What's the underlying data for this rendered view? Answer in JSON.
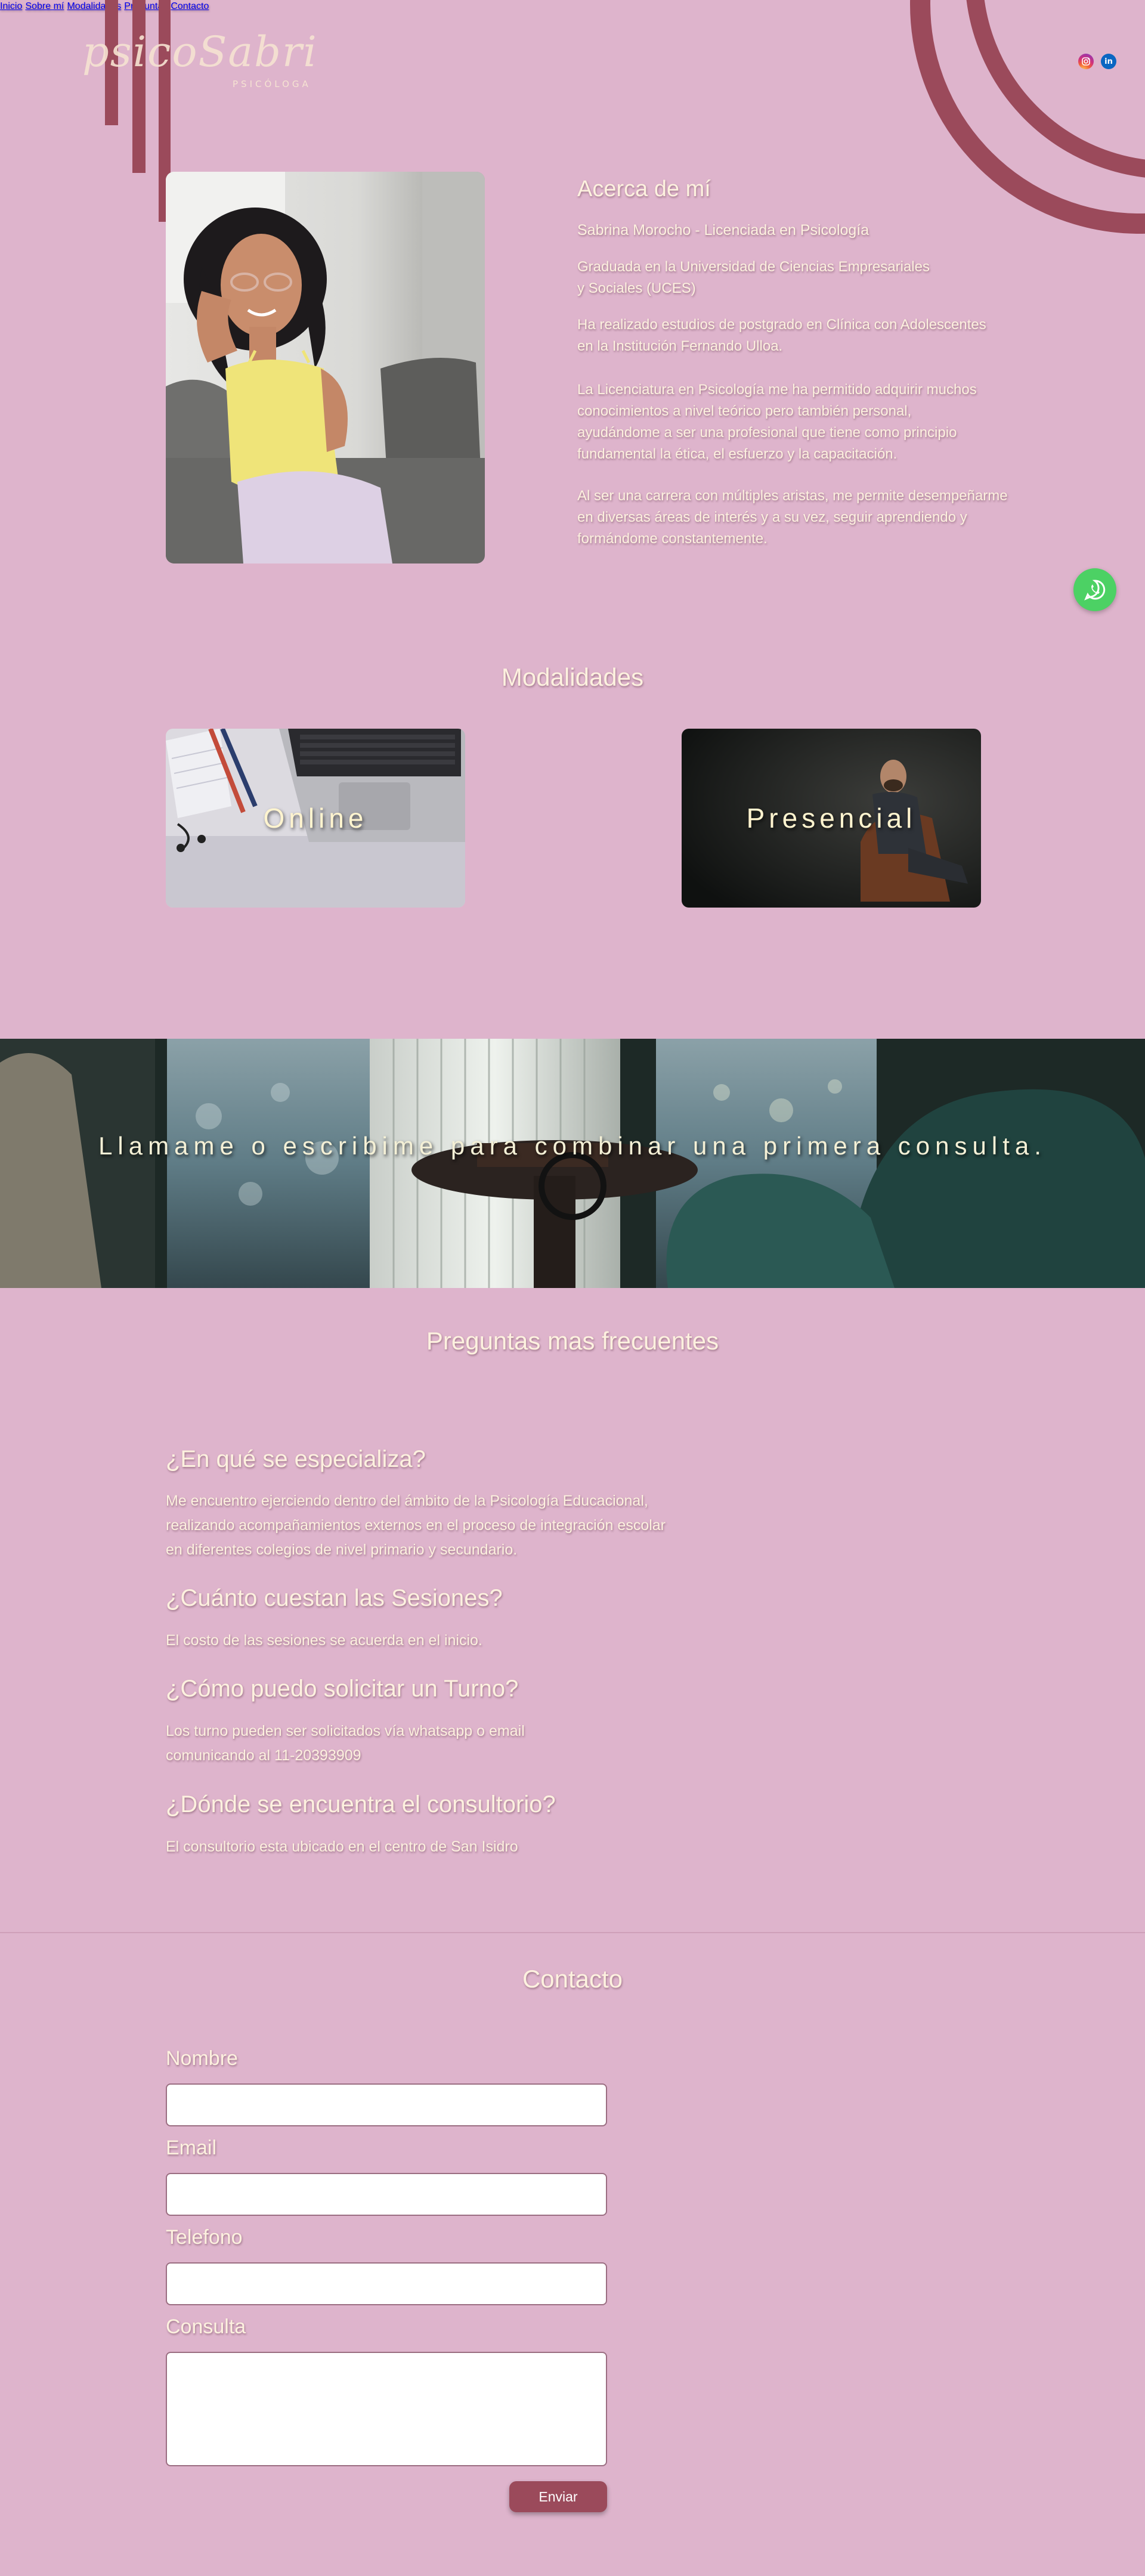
{
  "brand": {
    "logo_text": "psicoSabri",
    "logo_subtitle": "PSICÓLOGA"
  },
  "nav": {
    "items": [
      "Inicio",
      "Sobre mí",
      "Modalidades",
      "Preguntas",
      "Contacto"
    ]
  },
  "social": {
    "instagram": "instagram-icon",
    "linkedin": "in"
  },
  "about": {
    "title": "Acerca de mí",
    "subtitle": "Sabrina Morocho - Licenciada en Psicología",
    "paragraphs": [
      [
        "Graduada en la Universidad de Ciencias Empresariales",
        "y Sociales  (UCES)"
      ],
      [
        "Ha realizado estudios de postgrado en Clínica con Adolescentes",
        "en la Institución Fernando Ulloa."
      ],
      [
        "La Licenciatura en Psicología me ha permitido adquirir muchos",
        "conocimientos a nivel teórico pero también personal,",
        "ayudándome a ser una profesional que tiene como principio",
        "fundamental la ética, el esfuerzo y la capacitación."
      ],
      [
        "Al ser una carrera con múltiples aristas, me permite desempeñarme",
        "en diversas áreas de interés y a su vez, seguir aprendiendo y",
        "formándome constantemente."
      ]
    ]
  },
  "modalities": {
    "title": "Modalidades",
    "cards": [
      "Online",
      "Presencial"
    ]
  },
  "banner": {
    "text": "Llamame o escribime para combinar una primera consulta."
  },
  "faq": {
    "title": "Preguntas mas frecuentes",
    "items": [
      {
        "q": "¿En qué se especializa?",
        "a": [
          "Me encuentro ejerciendo dentro del ámbito de la Psicología Educacional,",
          "realizando acompañamientos externos en el proceso de integración escolar",
          "en diferentes colegios de nivel primario y secundario."
        ]
      },
      {
        "q": "¿Cuánto cuestan las Sesiones?",
        "a": [
          "El costo de las sesiones se acuerda en el inicio."
        ]
      },
      {
        "q": "¿Cómo puedo solicitar un Turno?",
        "a": [
          "Los turno pueden ser solicitados vía whatsapp o email",
          "comunicando al 11-20393909"
        ]
      },
      {
        "q": "¿Dónde se encuentra el consultorio?",
        "a": [
          "El consultorio esta ubicado en el centro de San Isidro"
        ]
      }
    ]
  },
  "contact": {
    "title": "Contacto",
    "labels": [
      "Nombre",
      "Email",
      "Telefono",
      "Consulta"
    ],
    "values": [
      "",
      "",
      "",
      ""
    ],
    "submit": "Enviar"
  },
  "colors": {
    "background": "#deb4cc",
    "accent": "#9b4a5b",
    "text": "#fdf1df",
    "whatsapp": "#4cd164"
  }
}
